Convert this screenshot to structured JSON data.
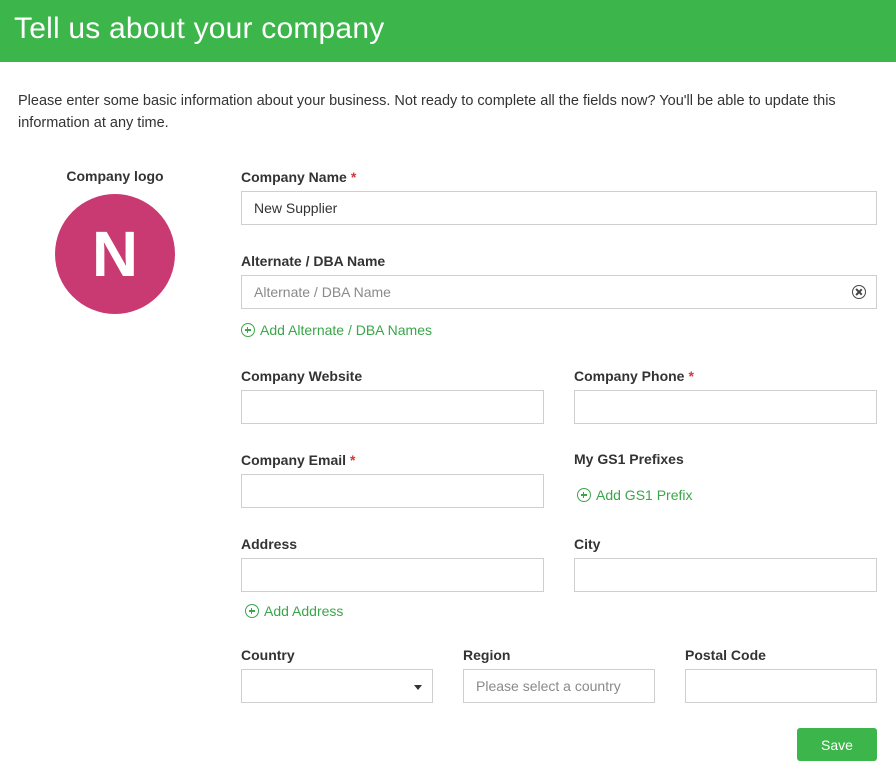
{
  "header": {
    "title": "Tell us about your company"
  },
  "intro": "Please enter some basic information about your business. Not ready to complete all the fields now? You'll be able to update this information at any time.",
  "logo": {
    "label": "Company logo",
    "initial": "N",
    "color": "#c93a73"
  },
  "required_marker": "*",
  "fields": {
    "company_name": {
      "label": "Company Name",
      "value": "New Supplier"
    },
    "dba_name": {
      "label": "Alternate / DBA Name",
      "placeholder": "Alternate / DBA Name"
    },
    "website": {
      "label": "Company Website",
      "value": ""
    },
    "phone": {
      "label": "Company Phone",
      "value": ""
    },
    "email": {
      "label": "Company Email",
      "value": ""
    },
    "gs1": {
      "label": "My GS1 Prefixes"
    },
    "address": {
      "label": "Address",
      "value": ""
    },
    "city": {
      "label": "City",
      "value": ""
    },
    "country": {
      "label": "Country",
      "value": ""
    },
    "region": {
      "label": "Region",
      "placeholder": "Please select a country"
    },
    "postal": {
      "label": "Postal Code",
      "value": ""
    }
  },
  "links": {
    "add_dba": "Add Alternate / DBA Names",
    "add_gs1": "Add GS1 Prefix",
    "add_address": "Add Address"
  },
  "save_label": "Save",
  "colors": {
    "brand": "#3cb54a",
    "link": "#3aa64a",
    "required": "#d0393b"
  }
}
